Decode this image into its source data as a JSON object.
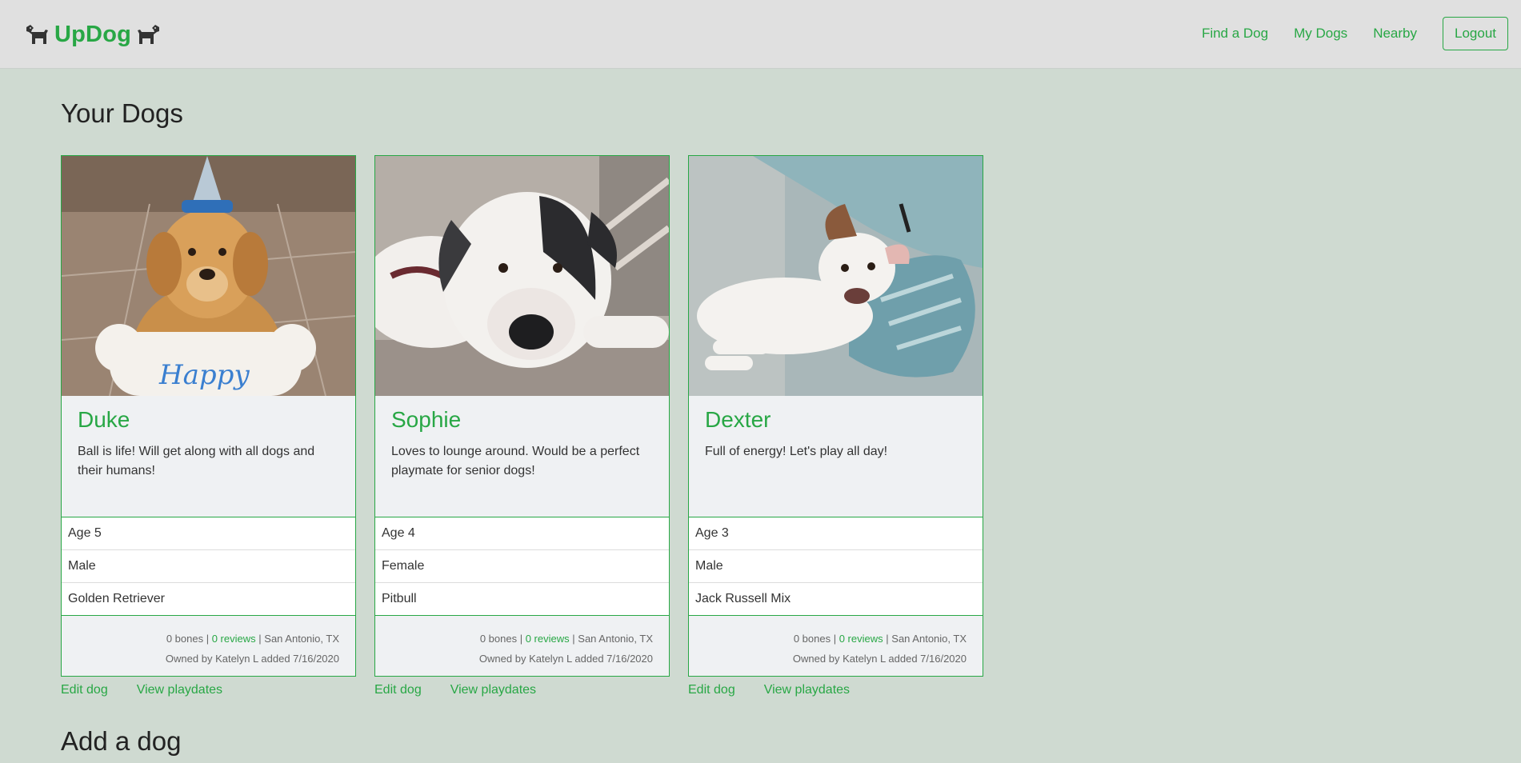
{
  "navbar": {
    "brand": "UpDog",
    "links": [
      "Find a Dog",
      "My Dogs",
      "Nearby"
    ],
    "logout": "Logout"
  },
  "page_title": "Your Dogs",
  "add_title": "Add a dog",
  "separator": "|",
  "dogs": [
    {
      "name": "Duke",
      "description": "Ball is life! Will get along with all dogs and their humans!",
      "age": "Age 5",
      "gender": "Male",
      "breed": "Golden Retriever",
      "bones": "0 bones",
      "reviews": "0 reviews",
      "location": "San Antonio, TX",
      "owner_line": "Owned by Katelyn L added 7/16/2020",
      "photo_overlay": "Happy"
    },
    {
      "name": "Sophie",
      "description": "Loves to lounge around. Would be a perfect playmate for senior dogs!",
      "age": "Age 4",
      "gender": "Female",
      "breed": "Pitbull",
      "bones": "0 bones",
      "reviews": "0 reviews",
      "location": "San Antonio, TX",
      "owner_line": "Owned by Katelyn L added 7/16/2020"
    },
    {
      "name": "Dexter",
      "description": "Full of energy! Let's play all day!",
      "age": "Age 3",
      "gender": "Male",
      "breed": "Jack Russell Mix",
      "bones": "0 bones",
      "reviews": "0 reviews",
      "location": "San Antonio, TX",
      "owner_line": "Owned by Katelyn L added 7/16/2020"
    }
  ],
  "actions": {
    "edit": "Edit dog",
    "playdates": "View playdates"
  },
  "colors": {
    "accent": "#28a745",
    "background": "#cfdad1",
    "navbar": "#e0e0e0"
  }
}
